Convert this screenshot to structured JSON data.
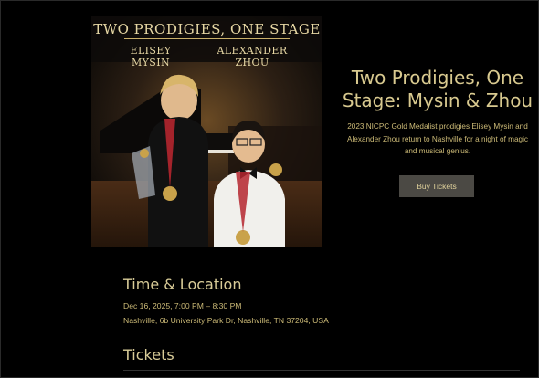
{
  "poster": {
    "title": "TWO PRODIGIES, ONE STAGE",
    "name_left_1": "ELISEY",
    "name_left_2": "MYSIN",
    "name_right_1": "ALEXANDER",
    "name_right_2": "ZHOU"
  },
  "event": {
    "title": "Two Prodigies, One Stage: Mysin & Zhou",
    "description": "2023 NICPC Gold Medalist prodigies Elisey Mysin and Alexander Zhou return to Nashville for a night of magic and musical genius.",
    "buy_label": "Buy Tickets"
  },
  "time_location": {
    "heading": "Time & Location",
    "date": "Dec 16, 2025, 7:00 PM – 8:30 PM",
    "address": "Nashville, 6b University Park Dr, Nashville, TN 37204, USA"
  },
  "tickets": {
    "heading": "Tickets"
  },
  "colors": {
    "background": "#000000",
    "gold_text": "#d8c98f",
    "button_bg": "#4b4944"
  }
}
